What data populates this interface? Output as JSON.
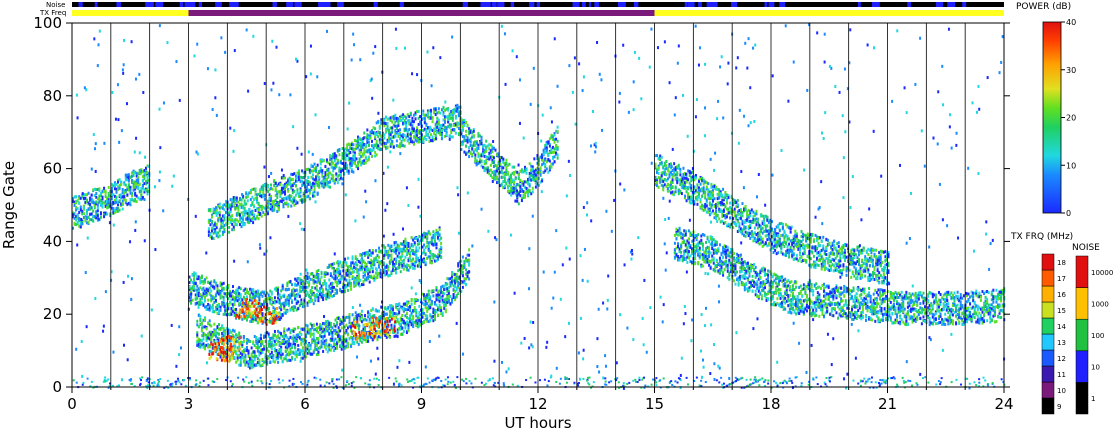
{
  "header": {
    "noise_label": "Noise",
    "txfreq_label": "TX Freq"
  },
  "chart_data": {
    "type": "heatmap",
    "title": "",
    "xlabel": "UT hours",
    "ylabel": "Range Gate",
    "xlim": [
      0,
      24
    ],
    "ylim": [
      0,
      100
    ],
    "x_ticks": [
      "0",
      "3",
      "6",
      "9",
      "12",
      "15",
      "18",
      "21",
      "24"
    ],
    "y_ticks": [
      "0",
      "20",
      "40",
      "60",
      "80",
      "100"
    ],
    "power_colorbar": {
      "title": "POWER (dB)",
      "range": [
        0,
        40
      ],
      "ticks": [
        "0",
        "10",
        "20",
        "30",
        "40"
      ]
    },
    "txfreq_colorbar": {
      "title": "TX FRQ (MHz)",
      "ticks": [
        "9",
        "10",
        "11",
        "12",
        "13",
        "14",
        "15",
        "16",
        "17",
        "18"
      ],
      "colors": [
        "#000000",
        "#7a1a7a",
        "#3a1ab0",
        "#1a5aff",
        "#20c8ff",
        "#20d060",
        "#c8e020",
        "#ffb000",
        "#ff5a00",
        "#e01010"
      ]
    },
    "noise_colorbar": {
      "title": "NOISE",
      "ticks": [
        "1",
        "10",
        "100",
        "1000",
        "10000"
      ],
      "colors": [
        "#000000",
        "#2020ff",
        "#20c040",
        "#ffc000",
        "#e01010"
      ]
    },
    "txfreq_strip": [
      {
        "start": 0,
        "end": 3,
        "level": "14"
      },
      {
        "start": 3,
        "end": 15,
        "level": "10"
      },
      {
        "start": 15,
        "end": 24,
        "level": "14"
      }
    ],
    "noise_strip_color": "#000000",
    "noise_strip_accent": "#2020ff",
    "echo_bands": [
      {
        "name": "",
        "points": [
          [
            3.0,
            28
          ],
          [
            4.0,
            24
          ],
          [
            5.0,
            22
          ],
          [
            6.0,
            27
          ],
          [
            7.0,
            31
          ],
          [
            8.0,
            35
          ],
          [
            9.0,
            38
          ],
          [
            9.5,
            40
          ]
        ]
      },
      {
        "name": "",
        "points": [
          [
            3.2,
            16
          ],
          [
            4.0,
            12
          ],
          [
            4.5,
            10
          ],
          [
            5.5,
            12
          ],
          [
            6.5,
            14
          ],
          [
            7.5,
            17
          ],
          [
            8.5,
            19
          ],
          [
            9.5,
            24
          ],
          [
            10.2,
            34
          ]
        ]
      },
      {
        "name": "",
        "points": [
          [
            3.5,
            45
          ],
          [
            5.0,
            52
          ],
          [
            6.0,
            56
          ],
          [
            7.0,
            62
          ],
          [
            8.0,
            70
          ],
          [
            9.0,
            72
          ],
          [
            10.0,
            74
          ]
        ]
      },
      {
        "name": "",
        "points": [
          [
            15.5,
            40
          ],
          [
            16.5,
            37
          ],
          [
            17.5,
            30
          ],
          [
            18.5,
            25
          ],
          [
            19.5,
            24
          ],
          [
            20.5,
            23
          ],
          [
            21.5,
            22
          ],
          [
            23.0,
            22
          ],
          [
            24.0,
            23
          ]
        ]
      },
      {
        "name": "",
        "points": [
          [
            0.0,
            48
          ],
          [
            0.5,
            50
          ],
          [
            1.0,
            52
          ],
          [
            1.5,
            55
          ],
          [
            2.0,
            57
          ]
        ]
      },
      {
        "name": "",
        "points": [
          [
            10.0,
            70
          ],
          [
            10.5,
            65
          ],
          [
            11.0,
            60
          ],
          [
            11.5,
            55
          ],
          [
            12.0,
            60
          ],
          [
            12.5,
            68
          ]
        ]
      },
      {
        "name": "",
        "points": [
          [
            15.0,
            60
          ],
          [
            16.0,
            55
          ],
          [
            17.0,
            48
          ],
          [
            18.0,
            42
          ],
          [
            19.0,
            38
          ],
          [
            20.0,
            35
          ],
          [
            21.0,
            33
          ]
        ]
      }
    ],
    "hot_spots": [
      [
        3.8,
        10
      ],
      [
        4.0,
        12
      ],
      [
        5.0,
        20
      ],
      [
        7.5,
        16
      ],
      [
        8.0,
        17
      ],
      [
        4.5,
        22
      ]
    ]
  }
}
